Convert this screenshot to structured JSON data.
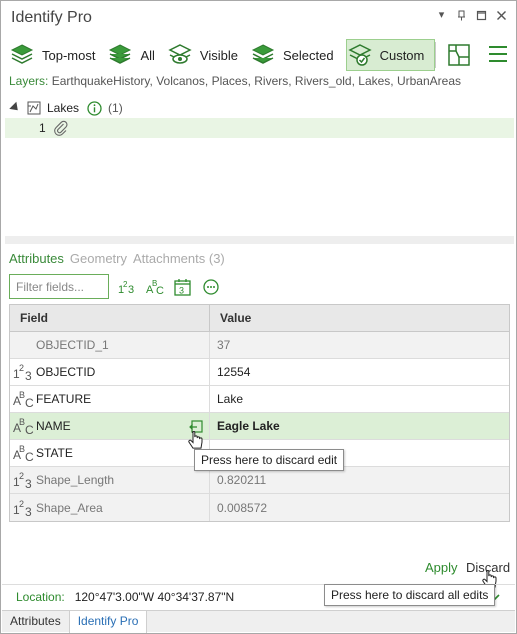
{
  "window": {
    "title": "Identify Pro",
    "controls": [
      "chevron-down-icon",
      "pin-icon",
      "maximize-icon",
      "close-icon"
    ]
  },
  "toolbar": {
    "buttons": [
      {
        "label": "Top-most",
        "icon": "layers-top-icon",
        "active": false
      },
      {
        "label": "All",
        "icon": "layers-all-icon",
        "active": false
      },
      {
        "label": "Visible",
        "icon": "layers-visible-icon",
        "active": false
      },
      {
        "label": "Selected",
        "icon": "layers-selected-icon",
        "active": false
      },
      {
        "label": "Custom",
        "icon": "layers-custom-icon",
        "active": true
      }
    ],
    "map_button_icon": "map-icon",
    "menu_icon": "hamburger-icon"
  },
  "layers": {
    "label": "Layers:",
    "value": "EarthquakeHistory, Volcanos, Places, Rivers, Rivers_old, Lakes, UrbanAreas"
  },
  "tree": {
    "layer_name": "Lakes",
    "layer_count": "(1)",
    "feature_id": "1"
  },
  "tabs": {
    "attributes": "Attributes",
    "geometry": "Geometry",
    "attachments": "Attachments (3)"
  },
  "filter": {
    "placeholder": "Filter fields..."
  },
  "grid": {
    "header_field": "Field",
    "header_value": "Value",
    "rows": [
      {
        "type": "",
        "field": "OBJECTID_1",
        "value": "37",
        "readonly": true
      },
      {
        "type": "number",
        "field": "OBJECTID",
        "value": "12554",
        "readonly": false
      },
      {
        "type": "text",
        "field": "FEATURE",
        "value": "Lake",
        "readonly": false
      },
      {
        "type": "text",
        "field": "NAME",
        "value": "Eagle Lake",
        "readonly": false,
        "edited": true
      },
      {
        "type": "text",
        "field": "STATE",
        "value": "",
        "readonly": false
      },
      {
        "type": "number",
        "field": "Shape_Length",
        "value": "0.820211",
        "readonly": true
      },
      {
        "type": "number",
        "field": "Shape_Area",
        "value": "0.008572",
        "readonly": true
      }
    ]
  },
  "tooltips": {
    "discard_edit": "Press here to discard edit",
    "discard_all": "Press here to discard all edits"
  },
  "actions": {
    "apply": "Apply",
    "discard": "Discard"
  },
  "location": {
    "label": "Location:",
    "value": "120°47'3.00\"W 40°34'37.87\"N"
  },
  "bottom_tabs": {
    "attributes": "Attributes",
    "identify_pro": "Identify Pro"
  },
  "colors": {
    "accent_green": "#2e8b2e",
    "edited_row": "#dcefd6",
    "active_tab_blue": "#2a6fb5"
  }
}
